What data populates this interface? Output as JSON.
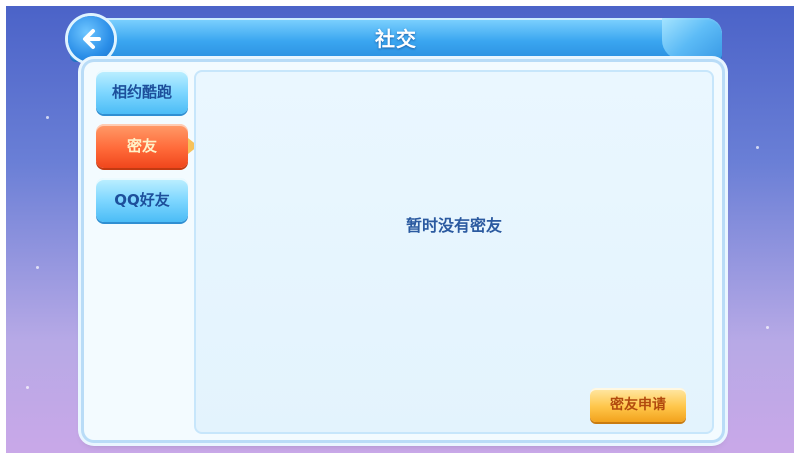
{
  "header": {
    "title": "社交",
    "back_icon": "arrow-left-icon"
  },
  "tabs": [
    {
      "label": "相约酷跑",
      "active": false
    },
    {
      "label": "密友",
      "active": true
    },
    {
      "label": "QQ好友",
      "active": false
    }
  ],
  "content": {
    "empty_message": "暂时没有密友"
  },
  "actions": {
    "apply_label": "密友申请"
  },
  "colors": {
    "accent_blue": "#3aa6f0",
    "active_tab": "#ff6b3a",
    "apply_button": "#ffc64a"
  }
}
